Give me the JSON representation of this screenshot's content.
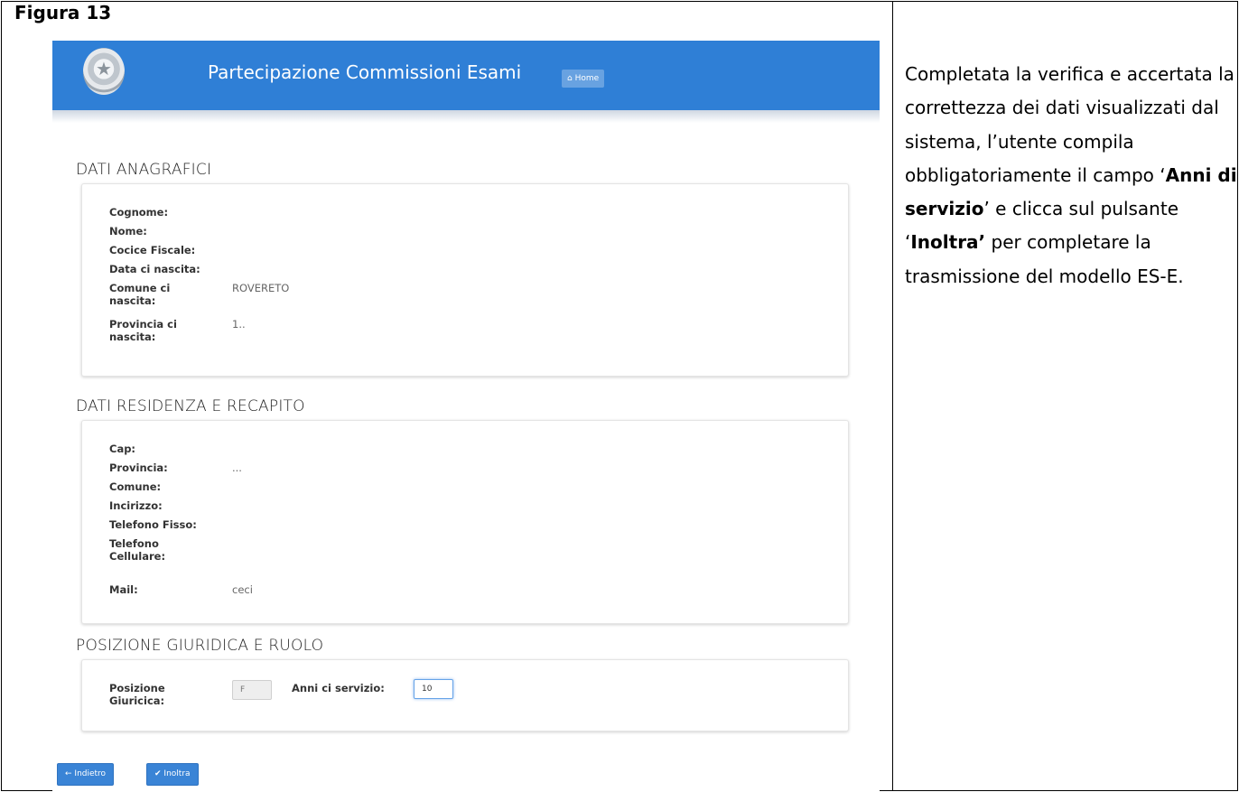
{
  "figure_label": "Figura 13",
  "app": {
    "title": "Partecipazione Commissioni Esami",
    "home_label": "Home",
    "icons": {
      "home": "home-icon",
      "emblem": "republic-emblem-icon"
    }
  },
  "sections": {
    "anagrafici": {
      "title": "DATI ANAGRAFICI",
      "rows": [
        {
          "label": "Cognome:",
          "value": ""
        },
        {
          "label": "Nome:",
          "value": ""
        },
        {
          "label": "Cocice Fiscale:",
          "value": ""
        },
        {
          "label": "Data ci nascita:",
          "value": ""
        },
        {
          "label": "Comune ci nascita:",
          "value": "ROVERETO"
        },
        {
          "label": "Provincia ci nascita:",
          "value": "1.."
        }
      ]
    },
    "residenza": {
      "title": "DATI RESIDENZA E RECAPITO",
      "rows": [
        {
          "label": "Cap:",
          "value": ""
        },
        {
          "label": "Provincia:",
          "value": "..."
        },
        {
          "label": "Comune:",
          "value": ""
        },
        {
          "label": "Incirizzo:",
          "value": ""
        },
        {
          "label": "Telefono Fisso:",
          "value": ""
        },
        {
          "label": "Telefono Cellulare:",
          "value": ""
        },
        {
          "label": "Mail:",
          "value": "ceci"
        }
      ]
    },
    "posizione": {
      "title": "POSIZIONE GIURIDICA E RUOLO",
      "posizione_label": "Posizione Giuricica:",
      "posizione_value": "F",
      "anni_label": "Anni ci servizio:",
      "anni_value": "10"
    }
  },
  "buttons": {
    "indietro": "Indietro",
    "inoltra": "Inoltra"
  },
  "right_text": {
    "p1": "Completata la verifica e accertata la correttezza dei dati visualizzati dal sistema, l’utente compila obbligatoriamente il campo ‘",
    "b1": "Anni di servizio",
    "p2": "’ e clicca sul pulsante ‘",
    "b2": "Inoltra’",
    "p3": " per completare la trasmissione del modello ES-E."
  }
}
